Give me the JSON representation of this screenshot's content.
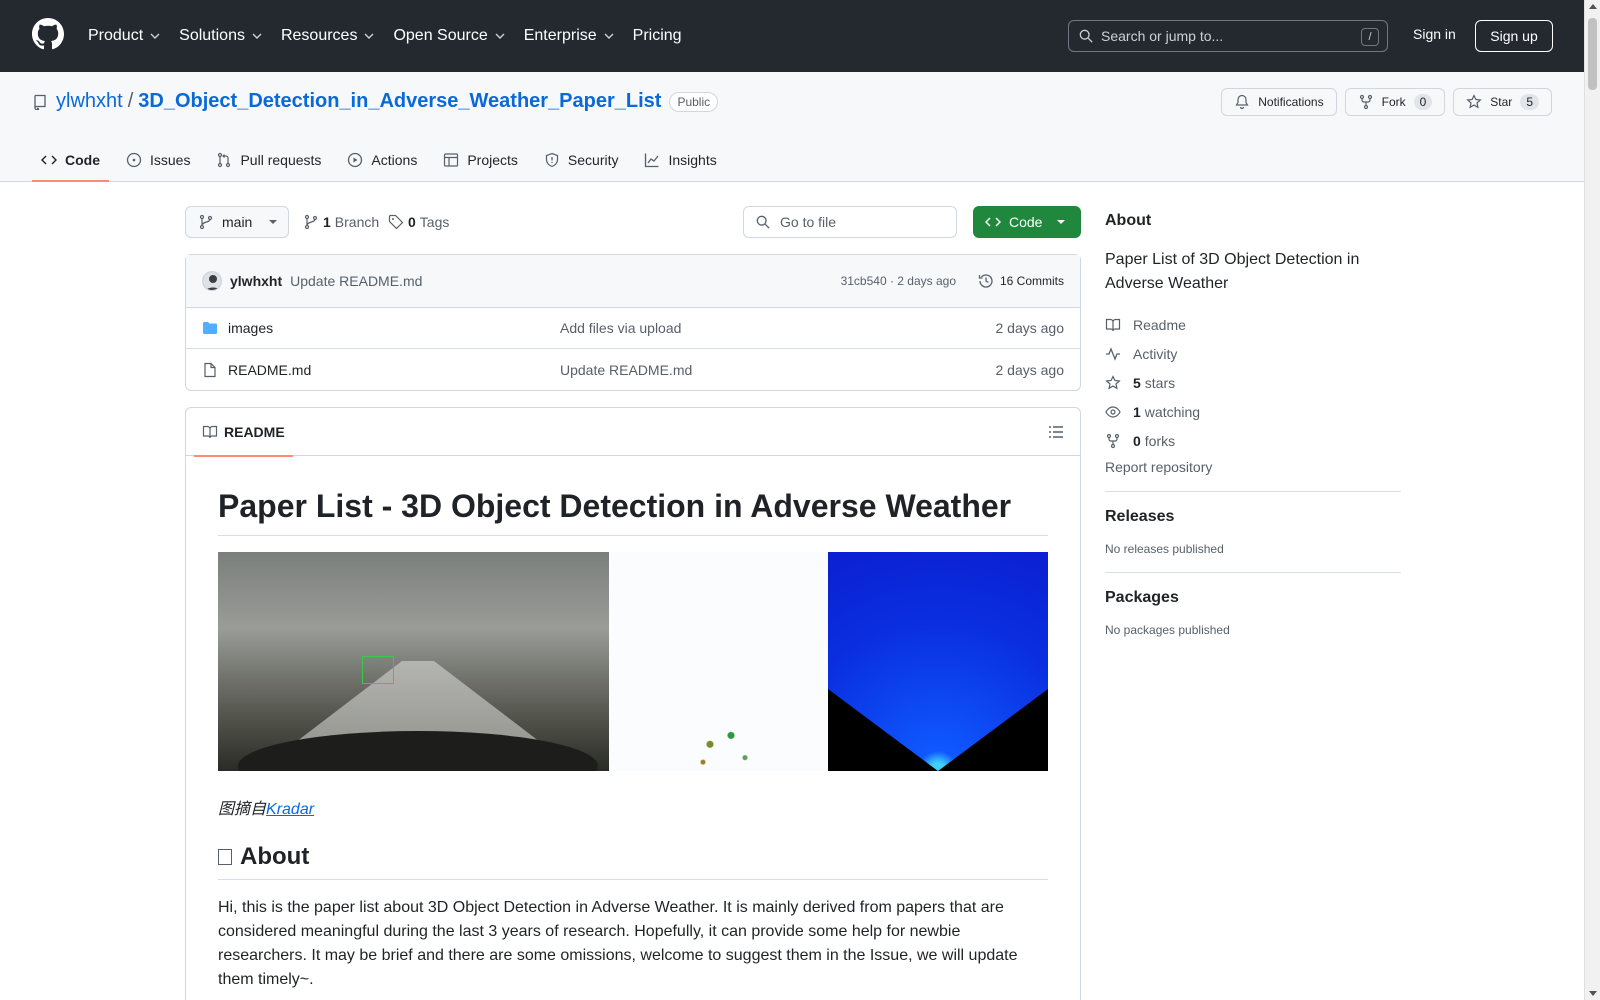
{
  "header": {
    "nav": [
      "Product",
      "Solutions",
      "Resources",
      "Open Source",
      "Enterprise",
      "Pricing"
    ],
    "search_placeholder": "Search or jump to...",
    "search_shortcut": "/",
    "sign_in": "Sign in",
    "sign_up": "Sign up"
  },
  "repo": {
    "owner": "ylwhxht",
    "separator": "/",
    "name": "3D_Object_Detection_in_Adverse_Weather_Paper_List",
    "visibility": "Public",
    "notifications_label": "Notifications",
    "fork_label": "Fork",
    "fork_count": "0",
    "star_label": "Star",
    "star_count": "5",
    "tabs": [
      "Code",
      "Issues",
      "Pull requests",
      "Actions",
      "Projects",
      "Security",
      "Insights"
    ],
    "active_tab": "Code"
  },
  "toolbar": {
    "branch": "main",
    "branch_count": "1",
    "branch_label": "Branch",
    "tag_count": "0",
    "tag_label": "Tags",
    "goto_placeholder": "Go to file",
    "code_label": "Code"
  },
  "latest_commit": {
    "author": "ylwhxht",
    "message": "Update README.md",
    "meta": "31cb540 · 2 days ago",
    "commits_label": "16 Commits"
  },
  "files": [
    {
      "name": "images",
      "type": "folder",
      "message": "Add files via upload",
      "date": "2 days ago"
    },
    {
      "name": "README.md",
      "type": "file",
      "message": "Update README.md",
      "date": "2 days ago"
    }
  ],
  "readme": {
    "tab_label": "README",
    "h1": "Paper List - 3D Object Detection in Adverse Weather",
    "caption_prefix": "图摘自",
    "caption_link": "Kradar",
    "h2_about": "About",
    "paragraph": "Hi, this is the paper list about 3D Object Detection in Adverse Weather. It is mainly derived from papers that are considered meaningful during the last 3 years of research. Hopefully, it can provide some help for newbie researchers.  It may be brief and there are some omissions, welcome to suggest them in the Issue, we will update them timely~."
  },
  "sidebar": {
    "about_title": "About",
    "description": "Paper List of 3D Object Detection in Adverse Weather",
    "readme_label": "Readme",
    "activity_label": "Activity",
    "stars_count": "5",
    "stars_label": "stars",
    "watching_count": "1",
    "watching_label": "watching",
    "forks_count": "0",
    "forks_label": "forks",
    "report_label": "Report repository",
    "releases_title": "Releases",
    "releases_empty": "No releases published",
    "packages_title": "Packages",
    "packages_empty": "No packages published"
  },
  "colors": {
    "header_bg": "#24292f",
    "link": "#0969da",
    "primary_button": "#1f883d",
    "active_tab_underline": "#fd8c73",
    "folder_icon": "#54aeff"
  }
}
